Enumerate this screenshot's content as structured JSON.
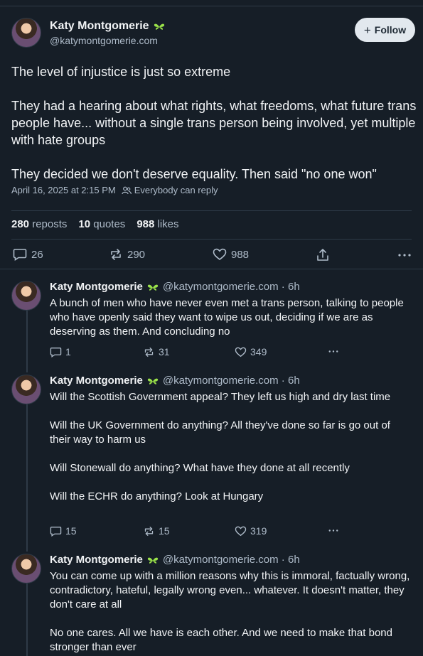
{
  "main_post": {
    "author_name": "Katy Montgomerie",
    "author_handle": "@katymontgomerie.com",
    "follow_label": "Follow",
    "paragraphs": [
      "The level of injustice is just so extreme",
      "They had a hearing about what rights, what freedoms, what future trans people have... without a single trans person being involved, yet multiple with hate groups",
      "They decided we don't deserve equality. Then said \"no one won\""
    ],
    "timestamp": "April 16, 2025 at 2:15 PM",
    "reply_setting": "Everybody can reply",
    "stats": {
      "reposts_count": "280",
      "reposts_label": "reposts",
      "quotes_count": "10",
      "quotes_label": "quotes",
      "likes_count": "988",
      "likes_label": "likes"
    },
    "actions": {
      "replies": "26",
      "reposts": "290",
      "likes": "988"
    }
  },
  "replies": [
    {
      "author_name": "Katy Montgomerie",
      "handle_time": "@katymontgomerie.com · 6h",
      "paragraphs": [
        "A bunch of men who have never even met a trans person, talking to people who have openly said they want to wipe us out, deciding if we are as deserving as them. And concluding no"
      ],
      "replies": "1",
      "reposts": "31",
      "likes": "349"
    },
    {
      "author_name": "Katy Montgomerie",
      "handle_time": "@katymontgomerie.com · 6h",
      "paragraphs": [
        "Will the Scottish Government appeal? They left us high and dry last time",
        "Will the UK Government do anything? All they've done so far is go out of their way to harm us",
        "Will Stonewall do anything? What have they done at all recently",
        "Will the ECHR do anything? Look at Hungary"
      ],
      "replies": "15",
      "reposts": "15",
      "likes": "319"
    },
    {
      "author_name": "Katy Montgomerie",
      "handle_time": "@katymontgomerie.com · 6h",
      "paragraphs": [
        "You can come up with a million reasons why this is immoral, factually wrong, contradictory, hateful, legally wrong even... whatever. It doesn't matter, they don't care at all",
        "No one cares. All we have is each other. And we need to make that bond stronger than ever"
      ]
    }
  ],
  "icons": {
    "badge": "green-butterfly-icon",
    "reply": "speech-bubble-icon",
    "repost": "repost-arrows-icon",
    "like": "heart-icon",
    "share": "share-icon",
    "more": "more-dots-icon",
    "people": "people-icon"
  }
}
